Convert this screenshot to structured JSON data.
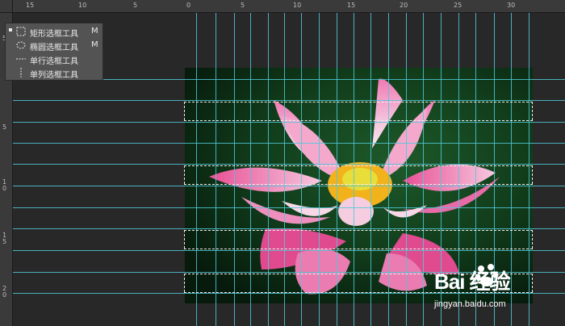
{
  "ruler": {
    "top_labels": [
      "15",
      "10",
      "5",
      "0",
      "5",
      "10",
      "15",
      "20",
      "25",
      "30"
    ],
    "left_labels": [
      "5",
      "5",
      "10",
      "15",
      "20"
    ]
  },
  "tool_menu": {
    "items": [
      {
        "label": "矩形选框工具",
        "shortcut": "M",
        "icon": "rect-marquee-icon",
        "selected": true
      },
      {
        "label": "椭圆选框工具",
        "shortcut": "M",
        "icon": "ellipse-marquee-icon",
        "selected": false
      },
      {
        "label": "单行选框工具",
        "shortcut": "",
        "icon": "single-row-marquee-icon",
        "selected": false
      },
      {
        "label": "单列选框工具",
        "shortcut": "",
        "icon": "single-column-marquee-icon",
        "selected": false
      }
    ]
  },
  "watermark": {
    "brand": "Bai 经验",
    "url": "jingyan.baidu.com"
  },
  "colors": {
    "guide": "#4fc8d8",
    "petal": "#e8569a",
    "center": "#f2b21c"
  }
}
